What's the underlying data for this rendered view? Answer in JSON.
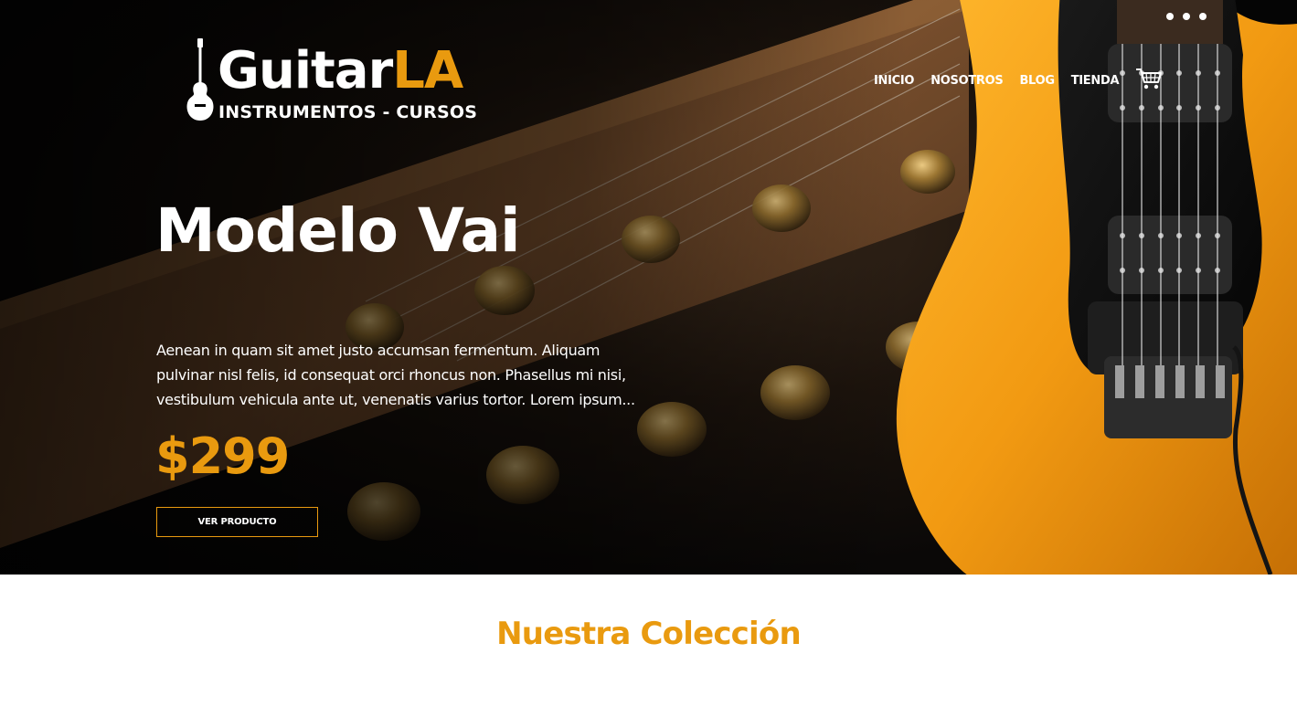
{
  "header": {
    "logo": {
      "word_main": "Guitar",
      "word_accent": "LA",
      "tagline": "INSTRUMENTOS - CURSOS",
      "icon": "guitar-icon"
    },
    "nav": {
      "items": [
        {
          "label": "INICIO"
        },
        {
          "label": "NOSOTROS"
        },
        {
          "label": "BLOG"
        },
        {
          "label": "TIENDA"
        }
      ],
      "cart_icon": "cart-icon"
    }
  },
  "hero": {
    "title": "Modelo Vai",
    "description": "Aenean in quam sit amet justo accumsan fermentum. Aliquam pulvinar nisl felis, id consequat orci rhoncus non. Phasellus mi nisi, vestibulum vehicula ante ut, venenatis varius tortor. Lorem ipsum...",
    "price": "$299",
    "button_label": "Ver Producto"
  },
  "collection": {
    "title": "Nuestra Colección"
  },
  "colors": {
    "accent": "#e99a0f",
    "guitar_body": "#f29a12",
    "text_light": "#ffffff"
  }
}
